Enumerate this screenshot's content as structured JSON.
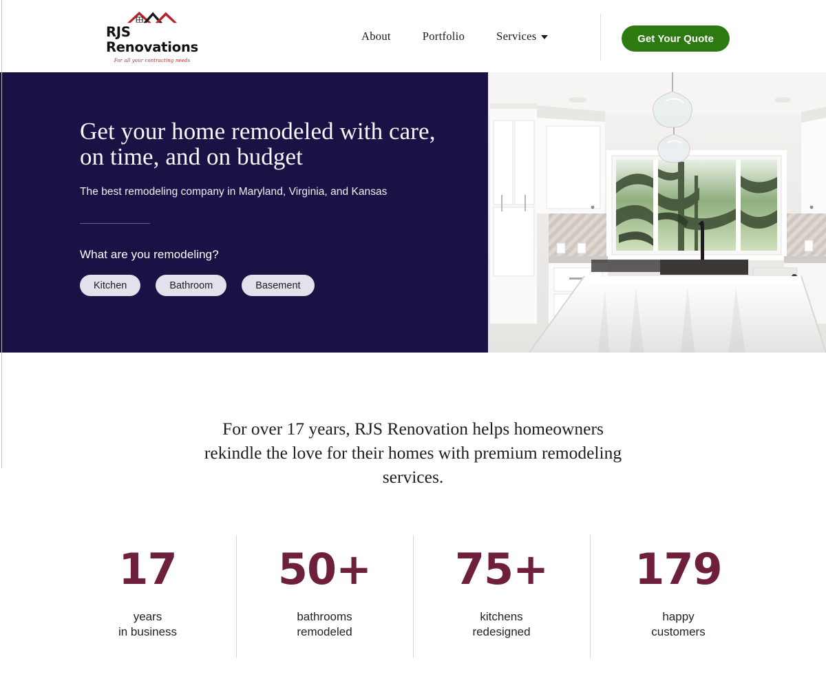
{
  "header": {
    "logo": {
      "name": "RJS Renovations",
      "tagline": "For all your contracting needs",
      "icon": "house-roof-logo-icon",
      "roof_red": "#b2262b",
      "roof_black": "#1a1a1a"
    },
    "nav": [
      {
        "label": "About",
        "has_dropdown": false
      },
      {
        "label": "Portfolio",
        "has_dropdown": false
      },
      {
        "label": "Services",
        "has_dropdown": true
      }
    ],
    "cta": {
      "label": "Get Your Quote",
      "color": "#2d7a11"
    }
  },
  "hero": {
    "background_color": "#1c1145",
    "title": "Get your home remodeled with care, on time, and on budget",
    "subtitle": "The best remodeling company in Maryland, Virginia, and Kansas",
    "question": "What are you remodeling?",
    "options": [
      {
        "label": "Kitchen"
      },
      {
        "label": "Bathroom"
      },
      {
        "label": "Basement"
      }
    ],
    "image_alt": "Modern white kitchen with island, pendant lights and large window"
  },
  "intro": {
    "paragraph": "For over 17 years, RJS Renovation helps homeowners rekindle the love for their homes with premium remodeling services."
  },
  "stats": {
    "accent_color": "#6d1f3c",
    "items": [
      {
        "number": "17",
        "label": "years\nin business"
      },
      {
        "number": "50+",
        "label": "bathrooms\nremodeled"
      },
      {
        "number": "75+",
        "label": "kitchens\nredesigned"
      },
      {
        "number": "179",
        "label": "happy\ncustomers"
      }
    ]
  }
}
